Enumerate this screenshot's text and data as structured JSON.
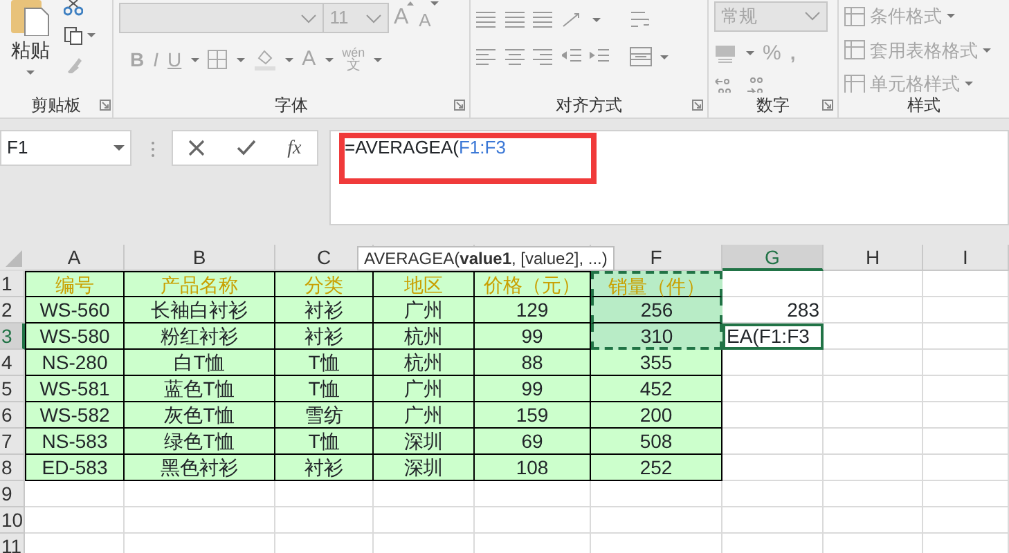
{
  "ribbon": {
    "disabled": true,
    "clipboard": {
      "paste": "粘贴",
      "label": "剪贴板"
    },
    "font": {
      "size": "11",
      "grow": "A",
      "shrink": "A",
      "bold": "B",
      "italic": "I",
      "underline": "U",
      "font_color": "A",
      "phonetic_top": "wén",
      "phonetic_bottom": "文",
      "label": "字体"
    },
    "alignment": {
      "label": "对齐方式"
    },
    "number": {
      "format": "常规",
      "percent": "%",
      "comma": ",",
      "label": "数字"
    },
    "styles": {
      "items": [
        "条件格式",
        "套用表格格式",
        "单元格样式"
      ],
      "label": "样式"
    }
  },
  "formula_bar": {
    "name_box": "F1",
    "fx": "fx",
    "formula": "=AVERAGEA(",
    "reference": "F1:F3"
  },
  "tooltip": "AVERAGEA(**value1**, [value2], ...)",
  "sheet": {
    "columns": [
      {
        "label": "A",
        "selected": false
      },
      {
        "label": "B",
        "selected": false
      },
      {
        "label": "C",
        "selected": false
      },
      {
        "selected": false
      },
      {
        "selected": false
      },
      {
        "label": "F",
        "selected": false
      },
      {
        "label": "G",
        "selected": true
      },
      {
        "label": "H",
        "selected": false
      },
      {
        "label": "I",
        "selected": false
      }
    ],
    "rows": [
      {
        "label": "1",
        "selected": false
      },
      {
        "label": "2",
        "selected": false,
        "column_g": {
          "text": "283",
          "kind": "number"
        }
      },
      {
        "label": "3",
        "selected": true,
        "column_g": {
          "text": "EA(F1:F3",
          "kind": "editing"
        }
      },
      {
        "label": "4",
        "selected": false
      },
      {
        "label": "5",
        "selected": false
      },
      {
        "label": "6",
        "selected": false
      },
      {
        "label": "7",
        "selected": false
      },
      {
        "label": "8",
        "selected": false
      },
      {
        "label": "9",
        "selected": false
      },
      {
        "label": "10",
        "selected": false
      },
      {
        "label": "11",
        "selected": false
      }
    ],
    "table": {
      "header": [
        "编号",
        "产品名称",
        "分类",
        "地区",
        "价格（元）",
        "销量（件）"
      ],
      "header_in_range": true,
      "rows": [
        {
          "cells": [
            "WS-560",
            "长袖白衬衫",
            "衬衫",
            "广州",
            "129",
            "256"
          ],
          "in_range": true
        },
        {
          "cells": [
            "WS-580",
            "粉红衬衫",
            "衬衫",
            "杭州",
            "99",
            "310"
          ],
          "in_range": true
        },
        {
          "cells": [
            "NS-280",
            "白T恤",
            "T恤",
            "杭州",
            "88",
            "355"
          ],
          "in_range": false
        },
        {
          "cells": [
            "WS-581",
            "蓝色T恤",
            "T恤",
            "广州",
            "99",
            "452"
          ],
          "in_range": false
        },
        {
          "cells": [
            "WS-582",
            "灰色T恤",
            "雪纺",
            "广州",
            "159",
            "200"
          ],
          "in_range": false
        },
        {
          "cells": [
            "NS-583",
            "绿色T恤",
            "T恤",
            "深圳",
            "69",
            "508"
          ],
          "in_range": false
        },
        {
          "cells": [
            "ED-583",
            "黑色衬衫",
            "衬衫",
            "深圳",
            "108",
            "252"
          ],
          "in_range": false
        }
      ]
    }
  }
}
